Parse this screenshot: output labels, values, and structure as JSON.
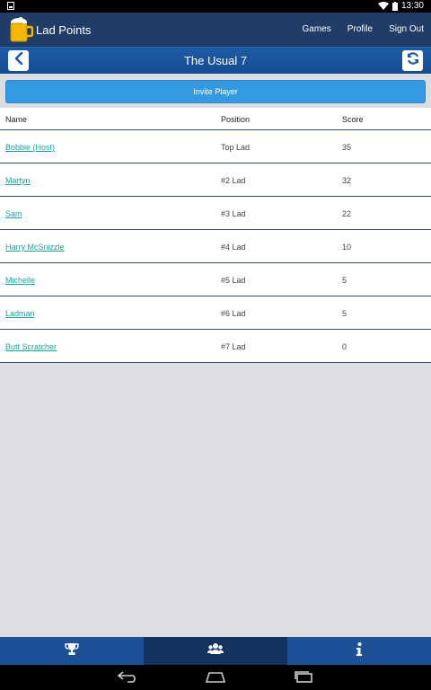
{
  "status_bar": {
    "time": "13:30"
  },
  "app": {
    "title": "Lad Points",
    "nav": [
      "Games",
      "Profile",
      "Sign Out"
    ]
  },
  "page": {
    "title": "The Usual 7",
    "invite_label": "Invite Player"
  },
  "table": {
    "headers": [
      "Name",
      "Position",
      "Score"
    ],
    "rows": [
      {
        "name": "Bobbie (Host)",
        "position": "Top Lad",
        "score": "35"
      },
      {
        "name": "Martyn",
        "position": "#2 Lad",
        "score": "32"
      },
      {
        "name": "Sam",
        "position": "#3 Lad",
        "score": "22"
      },
      {
        "name": "Harry McSnizzle",
        "position": "#4 Lad",
        "score": "10"
      },
      {
        "name": "Michelle",
        "position": "#5 Lad",
        "score": "5"
      },
      {
        "name": "Ladman",
        "position": "#6 Lad",
        "score": "5"
      },
      {
        "name": "Butt Scratcher",
        "position": "#7 Lad",
        "score": "0"
      }
    ]
  },
  "bottom_nav": [
    {
      "icon": "trophy-icon",
      "active": false
    },
    {
      "icon": "group-icon",
      "active": true
    },
    {
      "icon": "info-icon",
      "active": false
    }
  ],
  "colors": {
    "app_bar": "#1f3d66",
    "title_bar": "#1d5ba7",
    "invite": "#3399e0",
    "link": "#1aa29a",
    "bottom_nav": "#1d5197"
  }
}
